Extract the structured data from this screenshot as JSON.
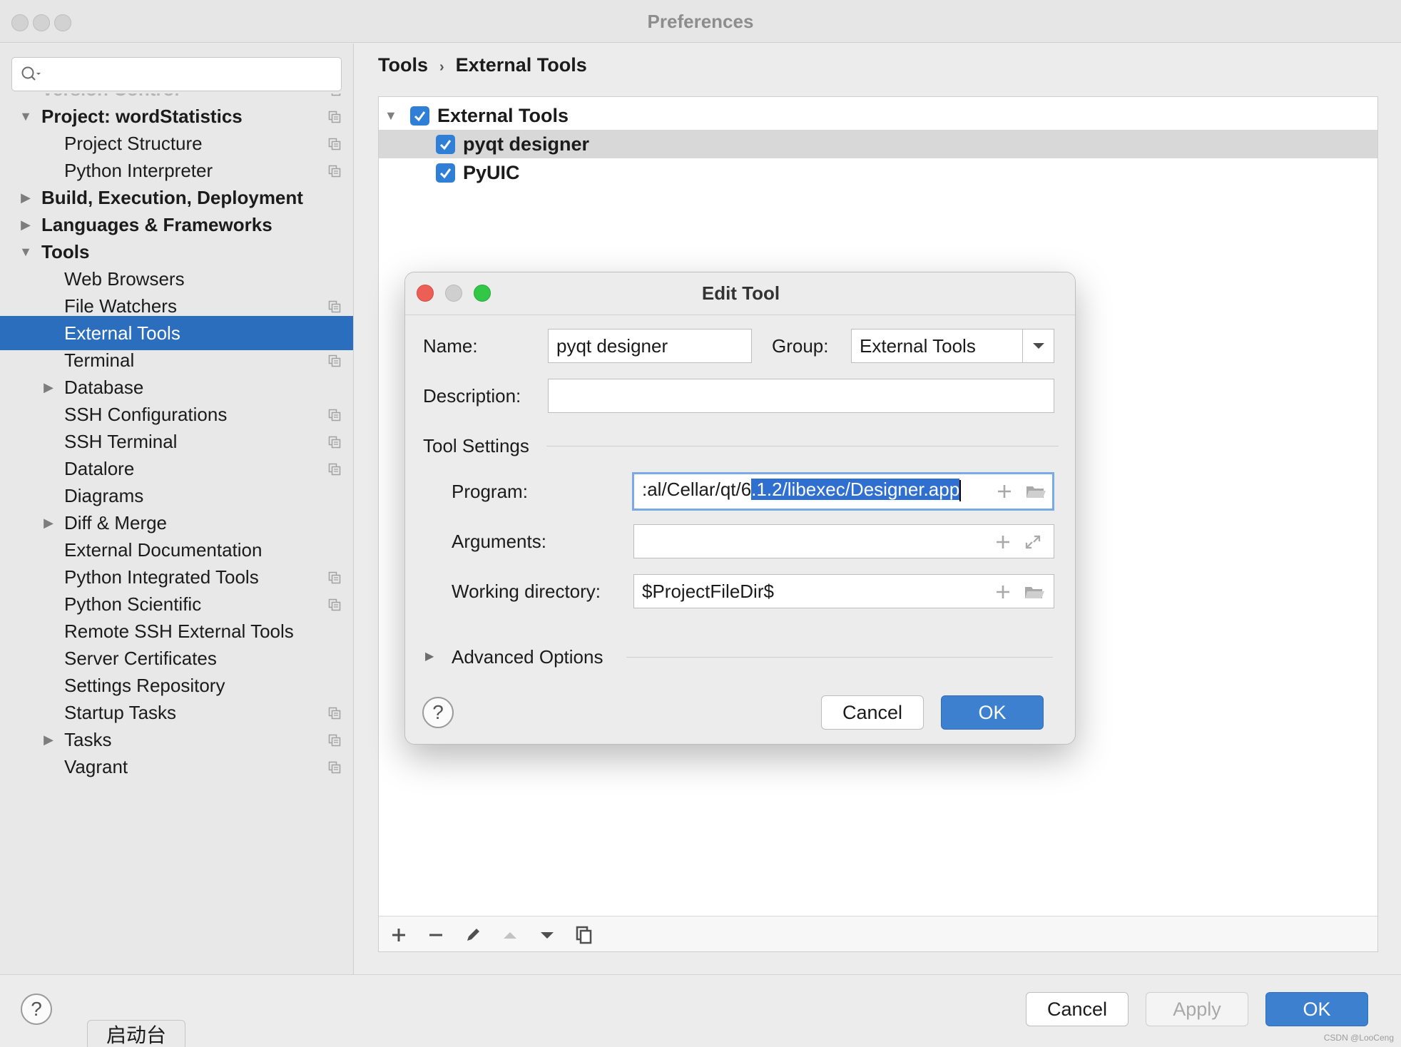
{
  "window": {
    "title": "Preferences"
  },
  "search": {
    "placeholder": ""
  },
  "sidebar": {
    "items": [
      {
        "label": "Version Control",
        "faded": true
      },
      {
        "label": "Project: wordStatistics",
        "expanded": true,
        "bold": true
      },
      {
        "label": "Project Structure"
      },
      {
        "label": "Python Interpreter"
      },
      {
        "label": "Build, Execution, Deployment",
        "bold": true
      },
      {
        "label": "Languages & Frameworks",
        "bold": true
      },
      {
        "label": "Tools",
        "expanded": true,
        "bold": true
      },
      {
        "label": "Web Browsers"
      },
      {
        "label": "File Watchers"
      },
      {
        "label": "External Tools",
        "selected": true
      },
      {
        "label": "Terminal"
      },
      {
        "label": "Database"
      },
      {
        "label": "SSH Configurations"
      },
      {
        "label": "SSH Terminal"
      },
      {
        "label": "Datalore"
      },
      {
        "label": "Diagrams"
      },
      {
        "label": "Diff & Merge"
      },
      {
        "label": "External Documentation"
      },
      {
        "label": "Python Integrated Tools"
      },
      {
        "label": "Python Scientific"
      },
      {
        "label": "Remote SSH External Tools"
      },
      {
        "label": "Server Certificates"
      },
      {
        "label": "Settings Repository"
      },
      {
        "label": "Startup Tasks"
      },
      {
        "label": "Tasks"
      },
      {
        "label": "Vagrant"
      }
    ]
  },
  "breadcrumb": {
    "parent": "Tools",
    "separator": "›",
    "current": "External Tools"
  },
  "tools_tree": {
    "group": {
      "label": "External Tools",
      "checked": true
    },
    "items": [
      {
        "label": "pyqt designer",
        "checked": true,
        "selected": true
      },
      {
        "label": "PyUIC",
        "checked": true
      }
    ]
  },
  "dialog": {
    "title": "Edit Tool",
    "name_label": "Name:",
    "name_value": "pyqt designer",
    "group_label": "Group:",
    "group_value": "External Tools",
    "description_label": "Description:",
    "description_value": "",
    "tool_settings_label": "Tool Settings",
    "program_label": "Program:",
    "program_value_unselected": ":al/Cellar/qt/6",
    "program_value_selected": ".1.2/libexec/Designer.app",
    "arguments_label": "Arguments:",
    "arguments_value": "",
    "working_dir_label": "Working directory:",
    "working_dir_value": "$ProjectFileDir$",
    "advanced_label": "Advanced Options",
    "help_label": "?",
    "cancel_label": "Cancel",
    "ok_label": "OK"
  },
  "footer": {
    "help_label": "?",
    "cancel_label": "Cancel",
    "apply_label": "Apply",
    "ok_label": "OK"
  },
  "dock_tooltip": "启动台",
  "watermark": "CSDN @LooCeng"
}
